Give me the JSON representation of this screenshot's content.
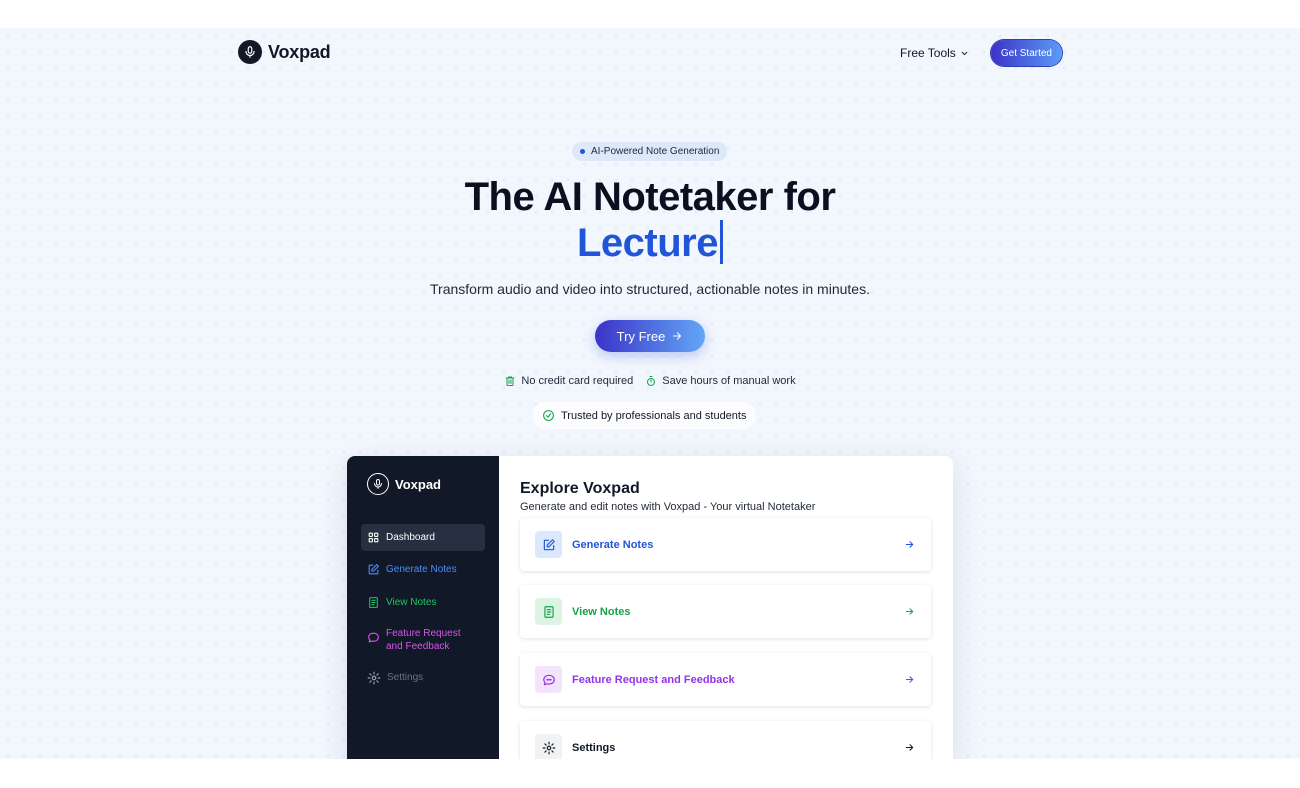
{
  "header": {
    "brand": "Voxpad",
    "free_tools_label": "Free Tools",
    "get_started_label": "Get Started"
  },
  "hero": {
    "badge": "AI-Powered Note Generation",
    "title": "The AI Notetaker for",
    "rotating_word": "Lecture",
    "subtitle": "Transform audio and video into structured, actionable notes in minutes.",
    "cta_label": "Try Free",
    "features": [
      "No credit card required",
      "Save hours of manual work"
    ],
    "trusted": "Trusted by professionals and students"
  },
  "preview": {
    "sidebar": {
      "brand": "Voxpad",
      "items": [
        {
          "label": "Dashboard",
          "icon": "grid-icon",
          "color": "#ffffff"
        },
        {
          "label": "Generate Notes",
          "icon": "edit-icon",
          "color": "#4d8cf5"
        },
        {
          "label": "View Notes",
          "icon": "document-icon",
          "color": "#22c55e"
        },
        {
          "label": "Feature Request and Feedback",
          "icon": "chat-bubble-icon",
          "color": "#d357e6"
        },
        {
          "label": "Settings",
          "icon": "gear-icon",
          "color": "#6b7280"
        }
      ]
    },
    "main": {
      "title": "Explore Voxpad",
      "subtitle": "Generate and edit notes with Voxpad - Your virtual Notetaker",
      "cards": [
        {
          "label": "Generate Notes",
          "icon": "edit-icon",
          "color": "#2155d8"
        },
        {
          "label": "View Notes",
          "icon": "document-icon",
          "color": "#16a34a"
        },
        {
          "label": "Feature Request and Feedback",
          "icon": "chat-bubble-icon",
          "color": "#9333ea"
        },
        {
          "label": "Settings",
          "icon": "gear-icon",
          "color": "#111827"
        }
      ]
    }
  },
  "colors": {
    "accent_blue": "#2155d8",
    "gradient_start": "#3b33c8",
    "gradient_end": "#5a9cf5",
    "sidebar_bg": "#111827",
    "page_bg": "#f2f6fd"
  }
}
